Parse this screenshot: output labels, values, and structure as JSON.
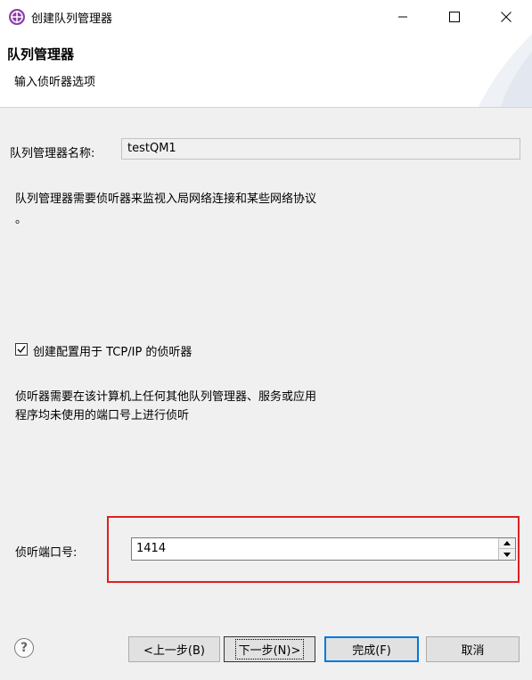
{
  "window": {
    "title": "创建队列管理器",
    "icon": "globe-icon"
  },
  "banner": {
    "title": "队列管理器",
    "subtitle": "输入侦听器选项"
  },
  "form": {
    "name_label": "队列管理器名称:",
    "name_value": "testQM1",
    "description_line1": "队列管理器需要侦听器来监视入局网络连接和某些网络协议",
    "description_line2": "。",
    "checkbox_label": "创建配置用于 TCP/IP 的侦听器",
    "checkbox_checked": true,
    "port_description_line1": "侦听器需要在该计算机上任何其他队列管理器、服务或应用",
    "port_description_line2": "程序均未使用的端口号上进行侦听",
    "port_label": "侦听端口号:",
    "port_value": "1414"
  },
  "buttons": {
    "back": "<上一步(B)",
    "next": "下一步(N)>",
    "finish": "完成(F)",
    "cancel": "取消",
    "help": "?"
  },
  "colors": {
    "highlight": "#e02020",
    "finish_border": "#0078d7",
    "app_icon": "#8c3fa8"
  }
}
